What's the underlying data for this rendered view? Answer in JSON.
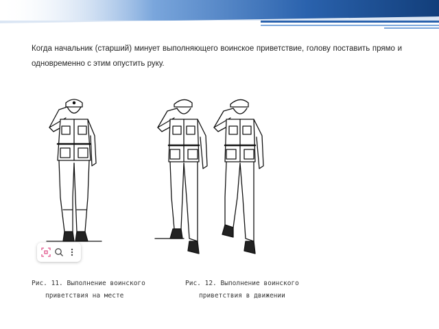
{
  "text": {
    "line1": "Когда начальник (старший) минует выполняющего воинское приветствие, голову поставить прямо и",
    "line2": "одновременно с этим опустить руку."
  },
  "captions": {
    "fig11_line1": "Рис. 11. Выполнение воинского",
    "fig11_line2": "приветствия на месте",
    "fig12_line1": "Рис. 12. Выполнение воинского",
    "fig12_line2": "приветствия в движении"
  },
  "toolbar": {
    "icons": [
      "scan-icon",
      "search-lens-icon",
      "more-vertical-icon"
    ]
  },
  "colors": {
    "banner_dark": "#1f4e8c",
    "banner_light": "#3f7fd0",
    "accent_pink": "#e0528a"
  }
}
